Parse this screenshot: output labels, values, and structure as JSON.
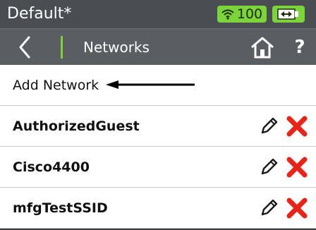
{
  "status_bar": {
    "profile_name": "Default*",
    "wifi_strength": "100",
    "battery_icon": "battery-charging-icon",
    "accent_color": "#7bd43a"
  },
  "nav_bar": {
    "back_icon": "chevron-left-icon",
    "title": "Networks",
    "home_icon": "home-icon",
    "help_label": "?"
  },
  "list": {
    "add_label": "Add Network",
    "networks": [
      {
        "name": "AuthorizedGuest"
      },
      {
        "name": "Cisco4400"
      },
      {
        "name": "mfgTestSSID"
      }
    ],
    "edit_icon": "pencil-icon",
    "delete_icon": "delete-x-icon",
    "delete_color": "#e8231a"
  }
}
